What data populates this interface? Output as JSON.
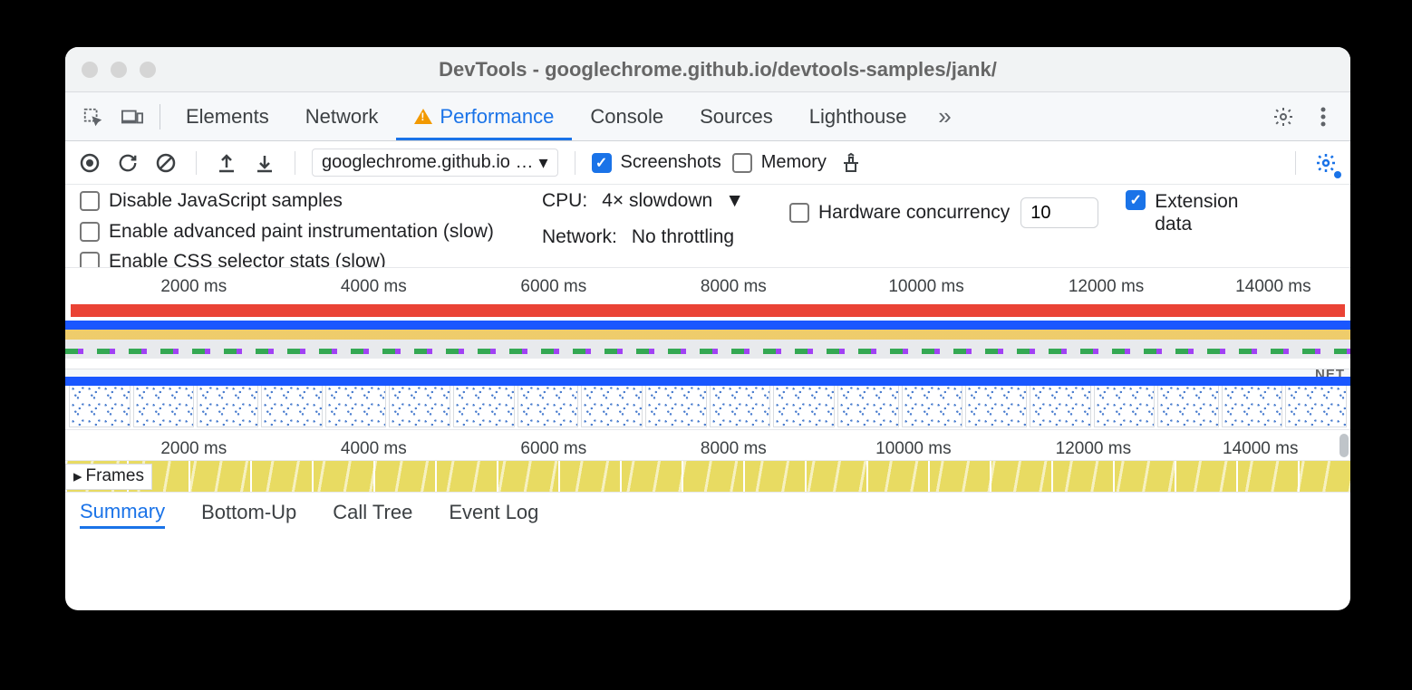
{
  "window": {
    "title": "DevTools - googlechrome.github.io/devtools-samples/jank/"
  },
  "tabs": {
    "items": [
      "Elements",
      "Network",
      "Performance",
      "Console",
      "Sources",
      "Lighthouse"
    ],
    "active": "Performance"
  },
  "toolbar": {
    "target_label": "googlechrome.github.io …",
    "screenshots_label": "Screenshots",
    "screenshots_on": true,
    "memory_label": "Memory",
    "memory_on": false
  },
  "settings": {
    "disable_js_label": "Disable JavaScript samples",
    "advanced_paint_label": "Enable advanced paint instrumentation (slow)",
    "css_stats_label": "Enable CSS selector stats (slow)",
    "cpu_label": "CPU:",
    "cpu_value": "4× slowdown",
    "network_label": "Network:",
    "network_value": "No throttling",
    "hw_label": "Hardware concurrency",
    "hw_value": "10",
    "ext_label": "Extension data",
    "ext_on": true
  },
  "timeline": {
    "ticks": [
      "2000 ms",
      "4000 ms",
      "6000 ms",
      "8000 ms",
      "10000 ms",
      "12000 ms",
      "14000 ms"
    ],
    "net_label": "NET",
    "frames_label": "Frames"
  },
  "bottom_tabs": {
    "items": [
      "Summary",
      "Bottom-Up",
      "Call Tree",
      "Event Log"
    ],
    "active": "Summary"
  }
}
